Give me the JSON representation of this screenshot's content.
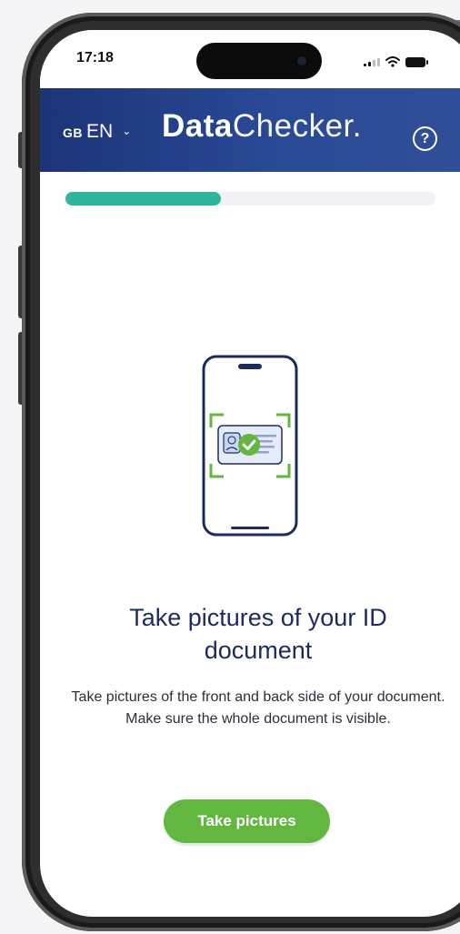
{
  "status_bar": {
    "time": "17:18"
  },
  "header": {
    "lang_code": "GB",
    "lang_name": "EN",
    "brand_bold": "Data",
    "brand_light": "Checker."
  },
  "progress": {
    "fraction": 0.42
  },
  "content": {
    "title": "Take pictures of your ID document",
    "description": "Take pictures of the front and back side of your document. Make sure the whole document is visible.",
    "button_label": "Take pictures"
  },
  "colors": {
    "header_bg": "#1c3478",
    "accent_green": "#61b73f",
    "progress_fill": "#2fb59c",
    "title_color": "#1c2b5f"
  },
  "icons": [
    "chevron-down-icon",
    "help-icon",
    "phone-id-scan-illustration",
    "check-icon",
    "signal-icon",
    "wifi-icon",
    "battery-icon"
  ]
}
